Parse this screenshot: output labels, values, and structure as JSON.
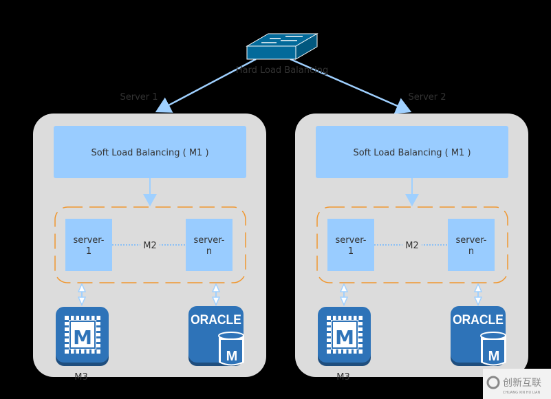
{
  "hard_lb": {
    "label": "Hard Load Balancing",
    "icon": "network-switch-icon"
  },
  "servers": [
    {
      "label": "Server 1",
      "soft_lb": "Soft Load Balancing ( M1 )",
      "node_a": "server-\n1",
      "node_a_line1": "server-",
      "node_a_line2": "1",
      "node_b_line1": "server-",
      "node_b_line2": "n",
      "cluster": "M2",
      "cache_label": "M3",
      "cache_icon": "memcache-chip-icon",
      "db_text": "ORACLE",
      "db_badge": "M"
    },
    {
      "label": "Server 2",
      "soft_lb": "Soft Load Balancing ( M1 )",
      "node_a_line1": "server-",
      "node_a_line2": "1",
      "node_b_line1": "server-",
      "node_b_line2": "n",
      "cluster": "M2",
      "cache_label": "M3",
      "cache_icon": "memcache-chip-icon",
      "db_text": "ORACLE",
      "db_badge": "M"
    }
  ],
  "watermark": {
    "text": "创新互联",
    "sub": "CHUANG XIN HU LIAN"
  },
  "colors": {
    "container": "#dcdcdc",
    "soft_lb": "#99ccff",
    "node": "#99ccff",
    "dashed": "#f0962e",
    "icon_blue": "#2e73b8",
    "arrow": "#9fd0ff",
    "switch": "#036a9a"
  }
}
